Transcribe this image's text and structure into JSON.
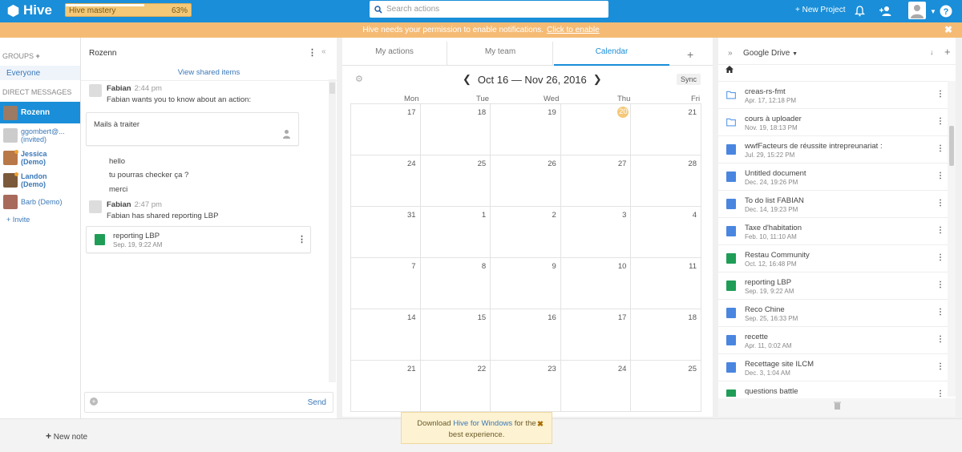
{
  "topbar": {
    "logo": "Hive",
    "mastery_label": "Hive mastery",
    "mastery_pct": "63%",
    "mastery_value": 0.63,
    "search_placeholder": "Search actions",
    "new_project": "+ New Project"
  },
  "notification": {
    "text": "Hive needs your permission to enable notifications.",
    "link": "Click to enable",
    "close": "✖"
  },
  "sidebar": {
    "groups_label": "GROUPS",
    "everyone": "Everyone",
    "dm_label": "DIRECT MESSAGES",
    "users": [
      {
        "name": "Rozenn"
      },
      {
        "name": "ggombert@...",
        "sub": "(invited)"
      },
      {
        "name": "Jessica",
        "sub": "(Demo)"
      },
      {
        "name": "Landon",
        "sub": "(Demo)"
      },
      {
        "name": "Barb (Demo)"
      }
    ],
    "invite": "+ Invite"
  },
  "chat": {
    "title": "Rozenn",
    "view_shared": "View shared items",
    "messages": [
      {
        "author": "Fabian",
        "time": "2:44 pm",
        "text": "Fabian wants you to know about an action:"
      },
      {
        "author": "Fabian",
        "time": "2:47 pm",
        "text": "Fabian has shared reporting LBP"
      }
    ],
    "action_card": "Mails à traiter",
    "lines": [
      "hello",
      "tu pourras checker ça ?",
      "merci"
    ],
    "shared_file": {
      "name": "reporting LBP",
      "date": "Sep. 19, 9:22 AM"
    },
    "send": "Send"
  },
  "calendar": {
    "tabs": [
      "My actions",
      "My team",
      "Calendar"
    ],
    "range": "Oct 16 — Nov 26, 2016",
    "sync": "Sync",
    "days": [
      "Mon",
      "Tue",
      "Wed",
      "Thu",
      "Fri"
    ],
    "weeks": [
      [
        "17",
        "18",
        "19",
        "20",
        "21"
      ],
      [
        "24",
        "25",
        "26",
        "27",
        "28"
      ],
      [
        "31",
        "1",
        "2",
        "3",
        "4"
      ],
      [
        "7",
        "8",
        "9",
        "10",
        "11"
      ],
      [
        "14",
        "15",
        "16",
        "17",
        "18"
      ],
      [
        "21",
        "22",
        "23",
        "24",
        "25"
      ]
    ]
  },
  "drive": {
    "title": "Google Drive",
    "files": [
      {
        "name": "creas-rs-fmt",
        "date": "Apr. 17, 12:18 PM",
        "type": "folder"
      },
      {
        "name": "cours à uploader",
        "date": "Nov. 19, 18:13 PM",
        "type": "folder"
      },
      {
        "name": "wwfFacteurs de réussite intrepreunariat :",
        "date": "Jul. 29, 15:22 PM",
        "type": "doc"
      },
      {
        "name": "Untitled document",
        "date": "Dec. 24, 19:26 PM",
        "type": "doc"
      },
      {
        "name": "To do list FABIAN",
        "date": "Dec. 14, 19:23 PM",
        "type": "doc"
      },
      {
        "name": "Taxe d'habitation",
        "date": "Feb. 10, 11:10 AM",
        "type": "doc"
      },
      {
        "name": "Restau Community",
        "date": "Oct. 12, 16:48 PM",
        "type": "sheet"
      },
      {
        "name": "reporting LBP",
        "date": "Sep. 19, 9:22 AM",
        "type": "sheet"
      },
      {
        "name": "Reco Chine",
        "date": "Sep. 25, 16:33 PM",
        "type": "doc"
      },
      {
        "name": "recette",
        "date": "Apr. 11, 0:02 AM",
        "type": "doc"
      },
      {
        "name": "Recettage site ILCM",
        "date": "Dec. 3, 1:04 AM",
        "type": "doc"
      },
      {
        "name": "questions battle",
        "date": "",
        "type": "sheet"
      }
    ]
  },
  "bottom": {
    "new_note": "New note",
    "toast_pre": "Download",
    "toast_link": "Hive for Windows",
    "toast_post": "for the best experience."
  },
  "colors": {
    "brand": "#1a8ed8",
    "notification": "#f5bb75",
    "today": "#f4c877"
  }
}
